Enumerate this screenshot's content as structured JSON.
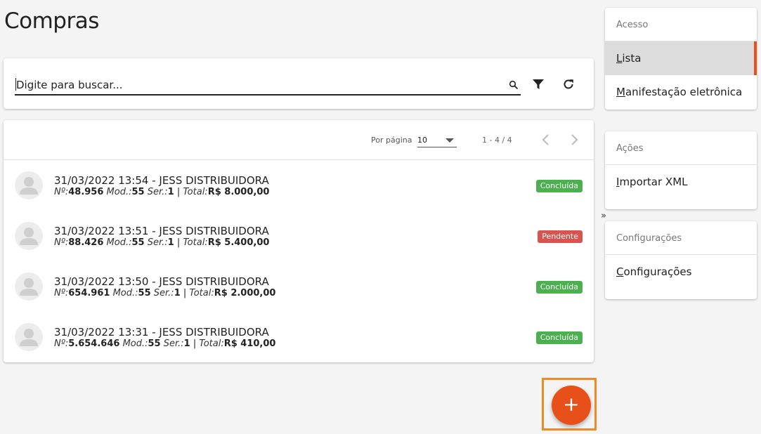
{
  "page": {
    "title": "Compras"
  },
  "search": {
    "placeholder": "Digite para buscar...",
    "value": ""
  },
  "pagination": {
    "per_page_label": "Por página",
    "per_page_value": "10",
    "range": "1 - 4 / 4"
  },
  "purchases": [
    {
      "title": "31/03/2022 13:54 - JESS DISTRIBUIDORA",
      "num_label": "Nº:",
      "num": "48.956",
      "mod_label": "Mod.:",
      "mod": "55",
      "ser_label": "Ser.:",
      "ser": "1",
      "total_label": "Total:",
      "total": "R$ 8.000,00",
      "status": "Concluída",
      "status_color": "#4caf50"
    },
    {
      "title": "31/03/2022 13:51 - JESS DISTRIBUIDORA",
      "num_label": "Nº:",
      "num": "88.426",
      "mod_label": "Mod.:",
      "mod": "55",
      "ser_label": "Ser.:",
      "ser": "1",
      "total_label": "Total:",
      "total": "R$ 5.400,00",
      "status": "Pendente",
      "status_color": "#d9534f"
    },
    {
      "title": "31/03/2022 13:50 - JESS DISTRIBUIDORA",
      "num_label": "Nº:",
      "num": "654.961",
      "mod_label": "Mod.:",
      "mod": "55",
      "ser_label": "Ser.:",
      "ser": "1",
      "total_label": "Total:",
      "total": "R$ 2.000,00",
      "status": "Concluída",
      "status_color": "#4caf50"
    },
    {
      "title": "31/03/2022 13:31 - JESS DISTRIBUIDORA",
      "num_label": "Nº:",
      "num": "5.654.646",
      "mod_label": "Mod.:",
      "mod": "55",
      "ser_label": "Ser.:",
      "ser": "1",
      "total_label": "Total:",
      "total": "R$ 410,00",
      "status": "Concluída",
      "status_color": "#4caf50"
    }
  ],
  "fab": {
    "label": "+",
    "color": "#e8501a"
  },
  "sidebar": {
    "collapse_label": "»",
    "sections": [
      {
        "header": "Acesso",
        "items": [
          {
            "first": "L",
            "rest": "ista",
            "active": true
          },
          {
            "first": "M",
            "rest": "anifestação eletrônica",
            "active": false
          }
        ]
      },
      {
        "header": "Ações",
        "items": [
          {
            "first": "I",
            "rest": "mportar XML",
            "active": false
          }
        ]
      },
      {
        "header": "Configurações",
        "items": [
          {
            "first": "C",
            "rest": "onfigurações",
            "active": false
          }
        ]
      }
    ]
  },
  "colors": {
    "accent": "#e8501a",
    "success": "#4caf50",
    "danger": "#d9534f",
    "highlight": "#f08a24"
  },
  "icons": [
    "search-icon",
    "filter-icon",
    "refresh-icon",
    "chevron-left-icon",
    "chevron-right-icon",
    "avatar-person-icon",
    "plus-icon"
  ]
}
